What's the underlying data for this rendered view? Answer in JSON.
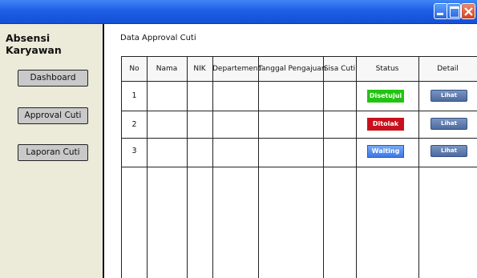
{
  "app": {
    "title": "Absensi Karyawan"
  },
  "sidebar": {
    "items": [
      {
        "label": "Dashboard"
      },
      {
        "label": "Approval Cuti"
      },
      {
        "label": "Laporan Cuti"
      }
    ]
  },
  "main": {
    "section_title": "Data Approval Cuti",
    "columns": [
      "No",
      "Nama",
      "NIK",
      "Departement",
      "Tanggal Pengajuan",
      "Sisa Cuti",
      "Status",
      "Detail"
    ],
    "rows": [
      {
        "no": "1",
        "status": "Disetujui",
        "detail": "Lihat Detail"
      },
      {
        "no": "2",
        "status": "Ditolak",
        "detail": "Lihat Detail"
      },
      {
        "no": "3",
        "status": "Waiting",
        "detail": "Lihat Detail"
      }
    ]
  },
  "colors": {
    "titlebar": "#1d5fe6",
    "sidebar_bg": "#ecead9",
    "status_approved": "#22c411",
    "status_rejected": "#c8101c",
    "status_waiting": "#3c78e6",
    "detail_button": "#4e6b9e"
  },
  "icons": [
    "minimize-icon",
    "maximize-icon",
    "close-icon"
  ]
}
